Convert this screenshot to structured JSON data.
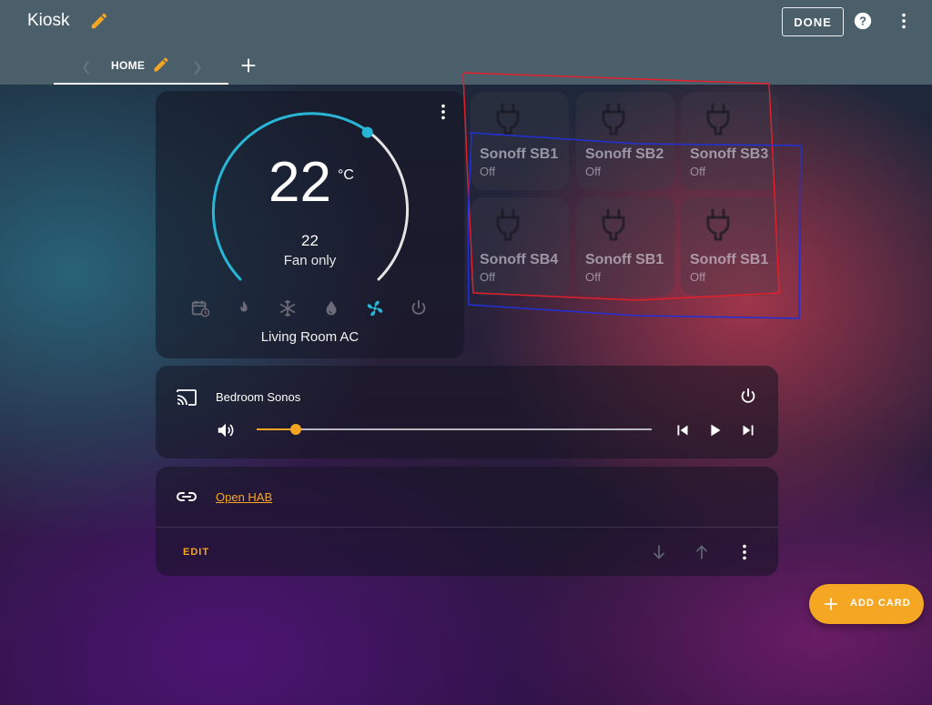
{
  "header": {
    "title": "Kiosk",
    "done_label": "DONE",
    "tabs": [
      {
        "label": "HOME"
      }
    ]
  },
  "thermostat": {
    "current_temp": "22",
    "unit": "°C",
    "target_temp": "22",
    "mode": "Fan only",
    "name": "Living Room AC",
    "modes": [
      "schedule",
      "heat",
      "cool",
      "dry",
      "fan",
      "off"
    ],
    "active_mode": "fan"
  },
  "switches": [
    {
      "name": "Sonoff SB1",
      "state": "Off"
    },
    {
      "name": "Sonoff SB2",
      "state": "Off"
    },
    {
      "name": "Sonoff SB3",
      "state": "Off"
    },
    {
      "name": "Sonoff SB4",
      "state": "Off"
    },
    {
      "name": "Sonoff SB1",
      "state": "Off"
    },
    {
      "name": "Sonoff SB1",
      "state": "Off"
    }
  ],
  "media": {
    "name": "Bedroom Sonos",
    "volume_percent": 10
  },
  "link": {
    "text": "Open HAB"
  },
  "card_actions": {
    "edit_label": "EDIT"
  },
  "fab": {
    "label": "ADD CARD"
  },
  "colors": {
    "accent": "#f5a623",
    "thermo_arc": "#29b6d6",
    "header_bg": "#4b5f6b",
    "annotation_red": "#e0202a",
    "annotation_blue": "#2230d8"
  }
}
